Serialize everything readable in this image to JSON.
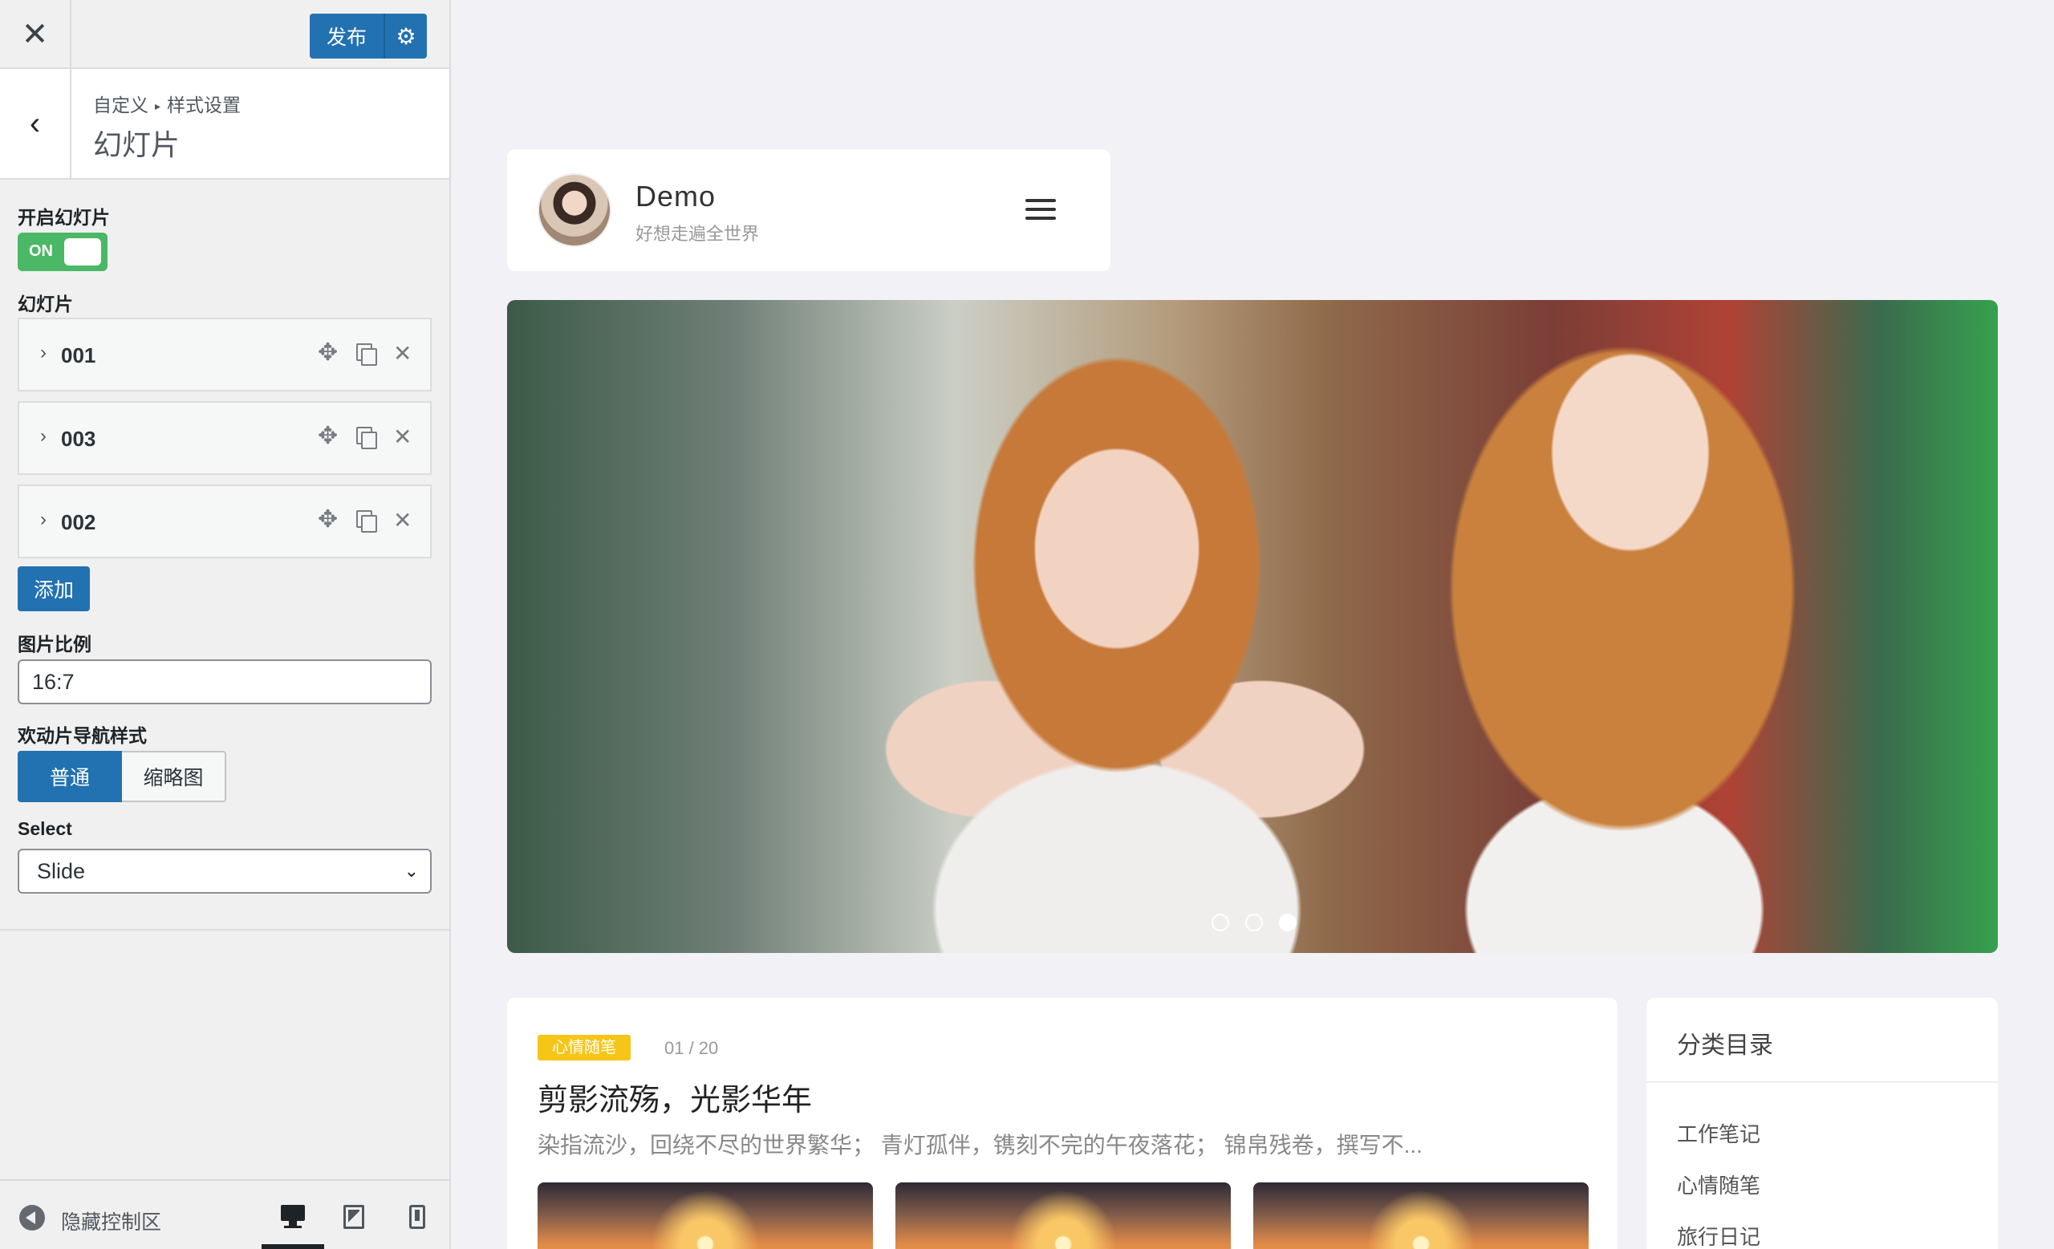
{
  "customizer": {
    "close_icon": "close-icon",
    "publish_label": "发布",
    "publish_settings_icon": "gear-icon",
    "breadcrumb": {
      "root": "自定义",
      "separator": "▸",
      "parent": "样式设置"
    },
    "section_title": "幻灯片",
    "controls": {
      "enable_label": "开启幻灯片",
      "toggle_text": "ON",
      "slides_label": "幻灯片",
      "slides": [
        {
          "name": "001"
        },
        {
          "name": "003"
        },
        {
          "name": "002"
        }
      ],
      "add_label": "添加",
      "ratio_label": "图片比例",
      "ratio_value": "16:7",
      "nav_style_label": "欢动片导航样式",
      "nav_style_options": [
        "普通",
        "缩略图"
      ],
      "nav_style_selected": "普通",
      "select_label": "Select",
      "select_value": "Slide"
    },
    "footer": {
      "hide_label": "隐藏控制区",
      "device_selected": "desktop"
    },
    "accent_color": "#2271b1",
    "toggle_color": "#4ab866"
  },
  "preview": {
    "site_title": "Demo",
    "site_tagline": "好想走遍全世界",
    "slider": {
      "total": 3,
      "active": 3
    },
    "post": {
      "tag": "心情随笔",
      "count": "01 / 20",
      "title": "剪影流殇，光影华年",
      "excerpt": "染指流沙，回绕不尽的世界繁华； 青灯孤伴，镌刻不完的午夜落花； 锦帛残卷，撰写不..."
    },
    "widget": {
      "title": "分类目录",
      "categories": [
        "工作笔记",
        "心情随笔",
        "旅行日记"
      ]
    },
    "tag_color": "#f5c518"
  }
}
